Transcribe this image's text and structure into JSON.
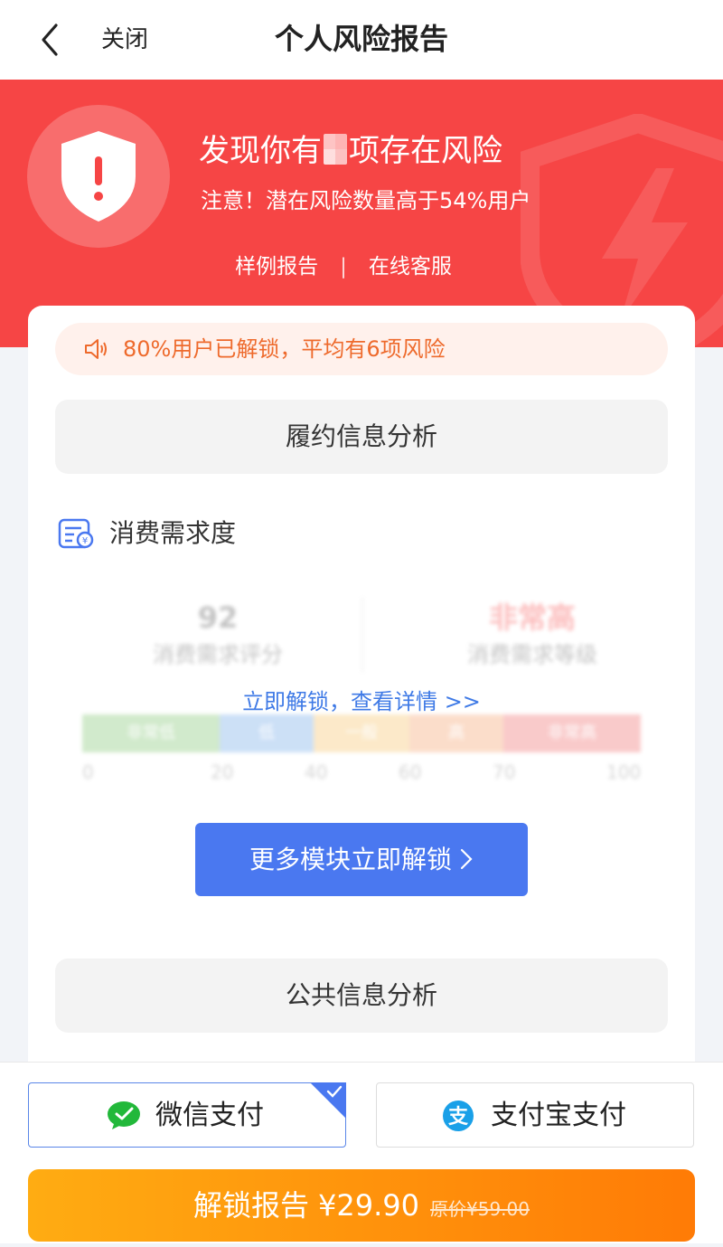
{
  "nav": {
    "back_icon": "chevron-left",
    "close_label": "关闭",
    "title": "个人风险报告"
  },
  "hero": {
    "headline_prefix": "发现你有",
    "headline_suffix": "项存在风险",
    "subline": "注意！潜在风险数量高于54%用户",
    "sample_link": "样例报告",
    "separator": "|",
    "service_link": "在线客服",
    "background_color": "#f64545"
  },
  "card": {
    "notice": "80%用户已解锁，平均有6项风险",
    "section1": "履约信息分析",
    "module_title": "消费需求度",
    "blurred": {
      "score": "92",
      "score_label": "消费需求评分",
      "level": "非常高",
      "level_label": "消费需求等级",
      "bands": [
        "非常低",
        "低",
        "一般",
        "高",
        "非常高"
      ],
      "ticks": [
        "0",
        "20",
        "40",
        "60",
        "70",
        "100"
      ]
    },
    "unlock_link": "立即解锁，查看详情 >>",
    "more_button": "更多模块立即解锁",
    "section2": "公共信息分析"
  },
  "payment": {
    "wechat_label": "微信支付",
    "alipay_label": "支付宝支付",
    "selected": "wechat",
    "cta_label": "解锁报告",
    "price": "¥29.90",
    "original_price": "原价¥59.00"
  }
}
